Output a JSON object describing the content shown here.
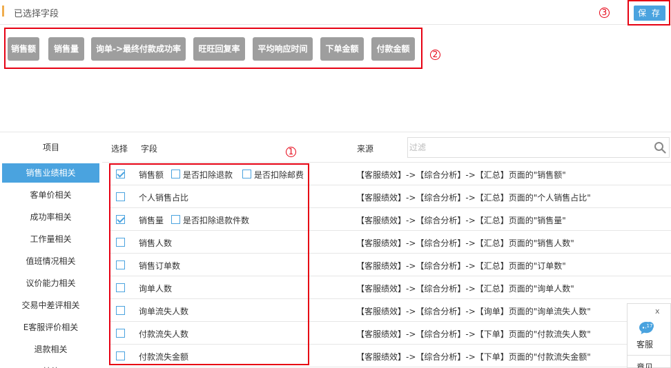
{
  "header": {
    "title": "已选择字段",
    "save_label": "保 存"
  },
  "annotations": {
    "one": "1",
    "two": "2",
    "three": "3"
  },
  "chips": [
    "销售额",
    "销售量",
    "询单->最终付款成功率",
    "旺旺回复率",
    "平均响应时间",
    "下单金额",
    "付款金额"
  ],
  "left": {
    "header": "项目",
    "items": [
      "销售业绩相关",
      "客单价相关",
      "成功率相关",
      "工作量相关",
      "值班情况相关",
      "议价能力相关",
      "交易中差评相关",
      "E客服评价相关",
      "退款相关",
      "其他"
    ]
  },
  "table": {
    "col_select": "选择",
    "col_field": "字段",
    "col_source": "来源",
    "filter_placeholder": "过滤",
    "rows": [
      {
        "field": "销售额",
        "sub1": "是否扣除退款",
        "sub2": "是否扣除邮费",
        "source": "【客服绩效】->【综合分析】->【汇总】页面的\"销售额\""
      },
      {
        "field": "个人销售占比",
        "source": "【客服绩效】->【综合分析】->【汇总】页面的\"个人销售占比\""
      },
      {
        "field": "销售量",
        "sub1": "是否扣除退款件数",
        "source": "【客服绩效】->【综合分析】->【汇总】页面的\"销售量\""
      },
      {
        "field": "销售人数",
        "source": "【客服绩效】->【综合分析】->【汇总】页面的\"销售人数\""
      },
      {
        "field": "销售订单数",
        "source": "【客服绩效】->【综合分析】->【汇总】页面的\"订单数\""
      },
      {
        "field": "询单人数",
        "source": "【客服绩效】->【综合分析】->【汇总】页面的\"询单人数\""
      },
      {
        "field": "询单流失人数",
        "source": "【客服绩效】->【综合分析】->【询单】页面的\"询单流失人数\""
      },
      {
        "field": "付款流失人数",
        "source": "【客服绩效】->【综合分析】->【下单】页面的\"付款流失人数\""
      },
      {
        "field": "付款流失金额",
        "source": "【客服绩效】->【综合分析】->【下单】页面的\"付款流失金额\""
      }
    ]
  },
  "service_panel": {
    "close": "x",
    "badge": "17",
    "label": "客服",
    "feedback": "意见"
  },
  "colors": {
    "accent": "#4aa3df",
    "annotation": "#e60012",
    "chip": "#9e9e9e",
    "title_bar": "#f0ad4e"
  }
}
